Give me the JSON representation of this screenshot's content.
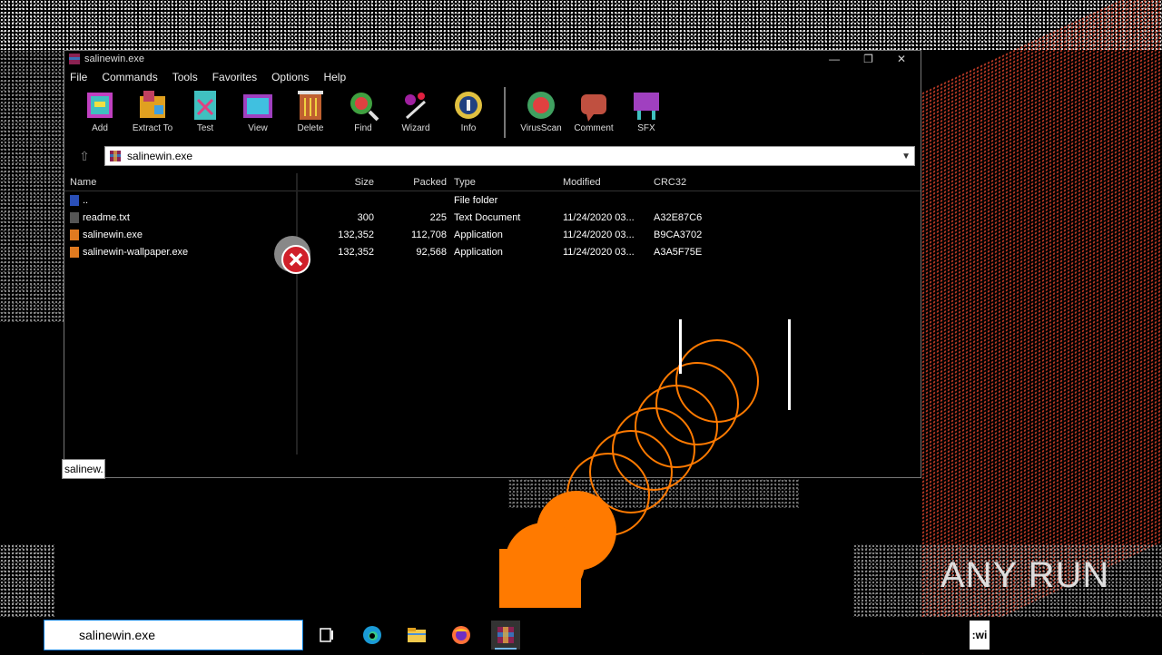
{
  "window": {
    "title": "salinewin.exe",
    "controls": [
      "—",
      "❐",
      "✕"
    ]
  },
  "menu": [
    "File",
    "Commands",
    "Tools",
    "Favorites",
    "Options",
    "Help"
  ],
  "toolbar": {
    "buttons": [
      {
        "label": "Add",
        "icon": "add-icon"
      },
      {
        "label": "Extract To",
        "icon": "extract-icon"
      },
      {
        "label": "Test",
        "icon": "test-icon"
      },
      {
        "label": "View",
        "icon": "view-icon"
      },
      {
        "label": "Delete",
        "icon": "delete-icon"
      },
      {
        "label": "Find",
        "icon": "find-icon"
      },
      {
        "label": "Wizard",
        "icon": "wizard-icon"
      },
      {
        "label": "Info",
        "icon": "info-icon"
      },
      {
        "label": "VirusScan",
        "icon": "virusscan-icon"
      },
      {
        "label": "Comment",
        "icon": "comment-icon"
      },
      {
        "label": "SFX",
        "icon": "sfx-icon"
      }
    ]
  },
  "addressbar": {
    "path": "salinewin.exe"
  },
  "filelist": {
    "headers": {
      "name": "Name",
      "size": "Size",
      "packed": "Packed",
      "type": "Type",
      "modified": "Modified",
      "crc": "CRC32"
    },
    "rows": [
      {
        "name": "..",
        "size": "",
        "packed": "",
        "type": "File folder",
        "modified": "",
        "crc": ""
      },
      {
        "name": "readme.txt",
        "size": "300",
        "packed": "225",
        "type": "Text Document",
        "modified": "11/24/2020 03...",
        "crc": "A32E87C6"
      },
      {
        "name": "salinewin.exe",
        "size": "132,352",
        "packed": "112,708",
        "type": "Application",
        "modified": "11/24/2020 03...",
        "crc": "B9CA3702"
      },
      {
        "name": "salinewin-wallpaper.exe",
        "size": "132,352",
        "packed": "92,568",
        "type": "Application",
        "modified": "11/24/2020 03...",
        "crc": "A3A5F75E"
      }
    ]
  },
  "tooltip": {
    "text": "salinew..."
  },
  "taskbar": {
    "search_value": "salinewin.exe",
    "tray_text": ":wi",
    "icons": [
      "task-view-icon",
      "edge-icon",
      "file-explorer-icon",
      "firefox-icon",
      "winrar-icon"
    ]
  },
  "watermark": {
    "text": "ANY RUN"
  },
  "colors": {
    "accent": "#ff7a00",
    "window_bg": "#000000",
    "noise_red": "#d8432c"
  }
}
